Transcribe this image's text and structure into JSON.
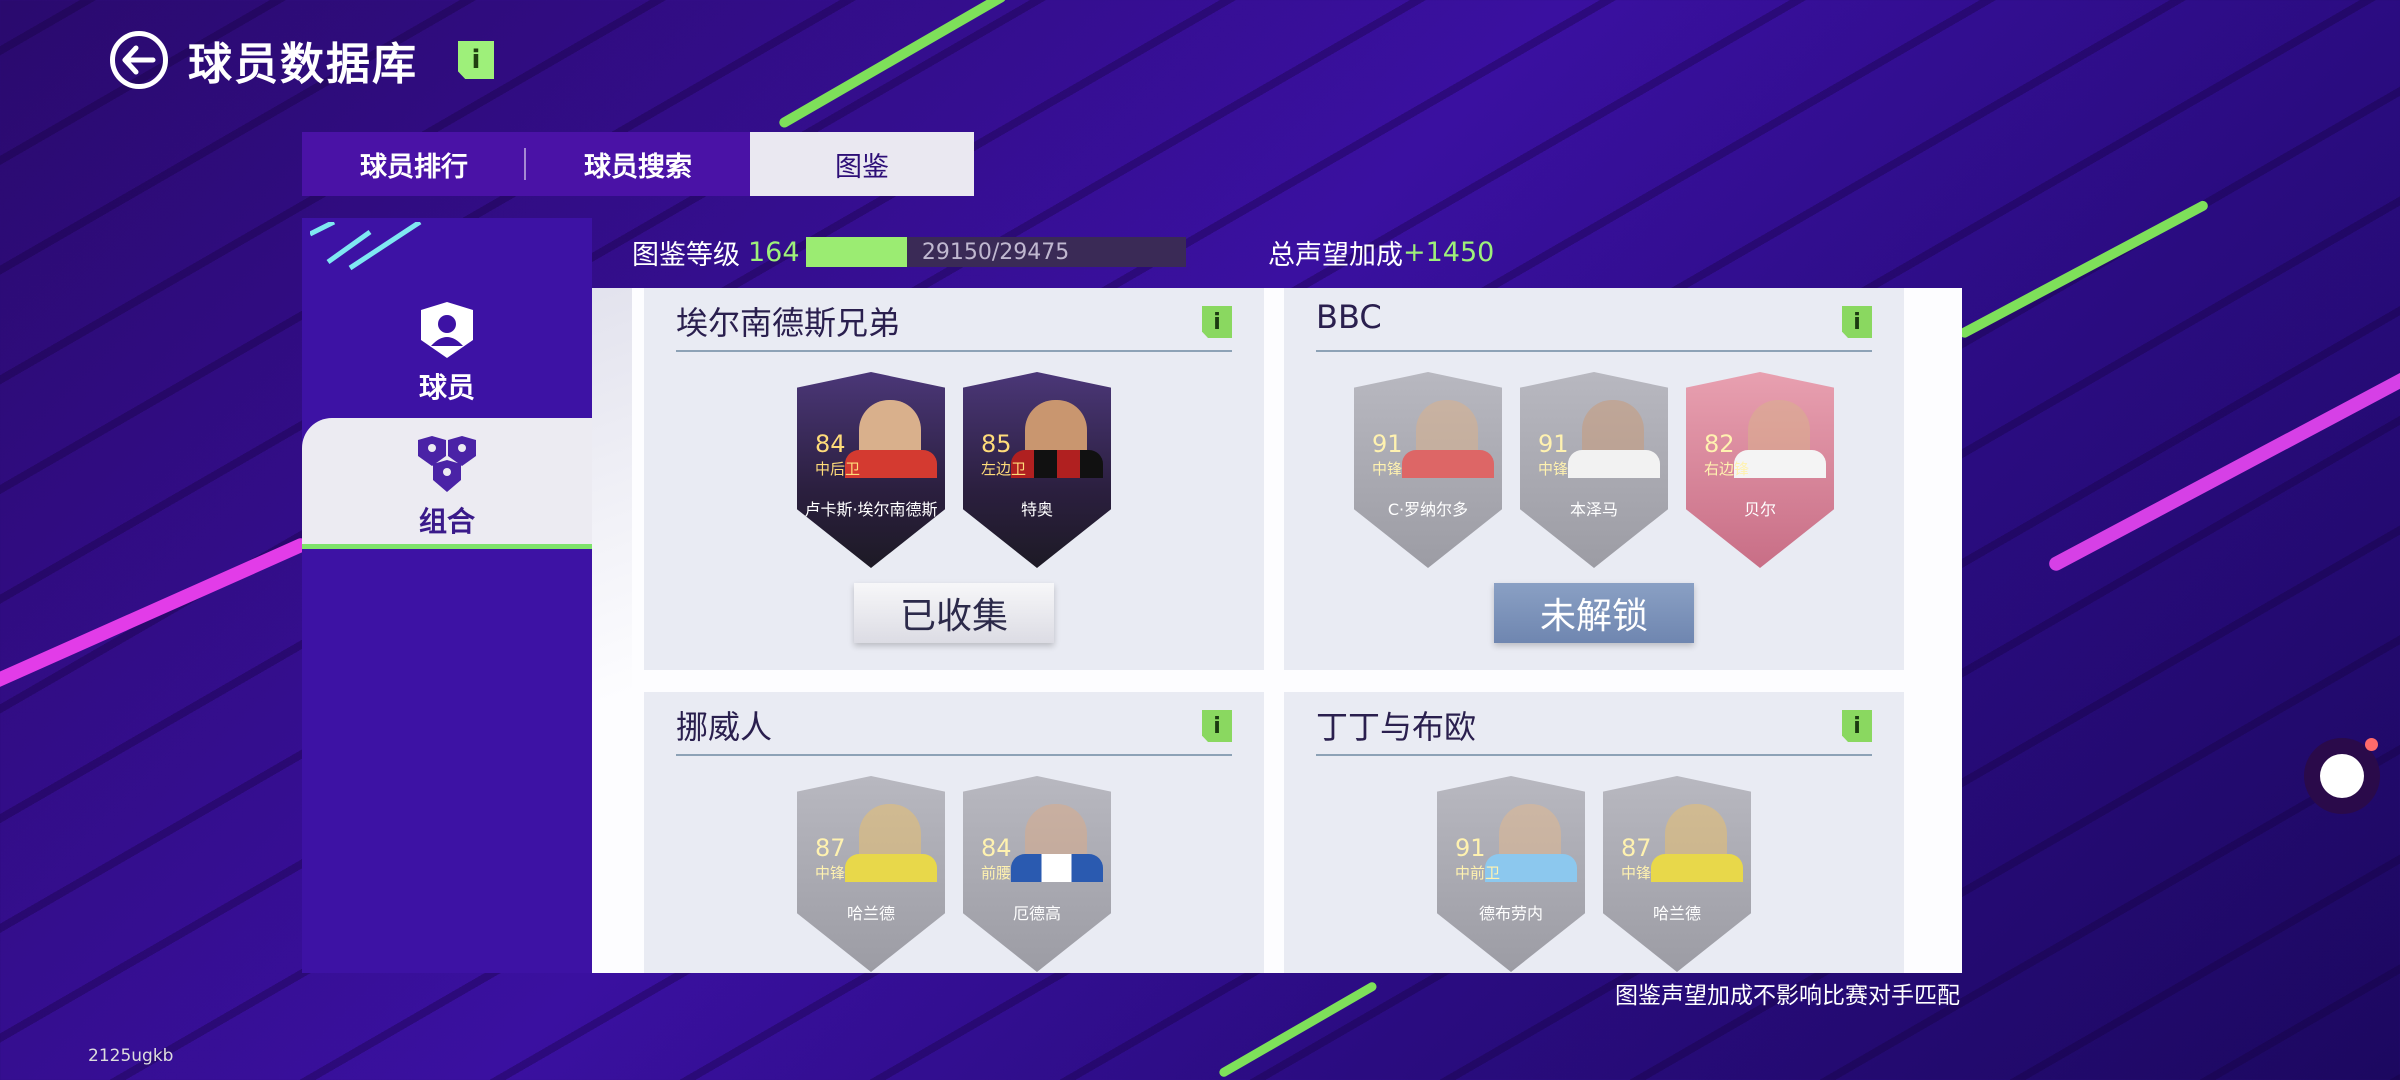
{
  "header": {
    "title": "球员数据库",
    "info_label": "i"
  },
  "tabs": [
    {
      "label": "球员排行"
    },
    {
      "label": "球员搜索"
    },
    {
      "label": "图鉴"
    }
  ],
  "sidebar": {
    "items": [
      {
        "label": "球员"
      },
      {
        "label": "组合"
      }
    ]
  },
  "progress": {
    "level_label": "图鉴等级",
    "level": "164",
    "value_text": "29150/29475",
    "fraction": 0.2668
  },
  "reputation": {
    "label": "总声望加成",
    "value": "+1450"
  },
  "cards": [
    {
      "title": "埃尔南德斯兄弟",
      "status": "已收集",
      "players": [
        {
          "rating": "84",
          "position": "中后卫",
          "name": "卢卡斯·埃尔南德斯"
        },
        {
          "rating": "85",
          "position": "左边卫",
          "name": "特奥"
        }
      ]
    },
    {
      "title": "BBC",
      "status": "未解锁",
      "players": [
        {
          "rating": "91",
          "position": "中锋",
          "name": "C·罗纳尔多"
        },
        {
          "rating": "91",
          "position": "中锋",
          "name": "本泽马"
        },
        {
          "rating": "82",
          "position": "右边锋",
          "name": "贝尔"
        }
      ]
    },
    {
      "title": "挪威人",
      "players": [
        {
          "rating": "87",
          "position": "中锋",
          "name": "哈兰德"
        },
        {
          "rating": "84",
          "position": "前腰",
          "name": "厄德高"
        }
      ]
    },
    {
      "title": "丁丁与布欧",
      "players": [
        {
          "rating": "91",
          "position": "中前卫",
          "name": "德布劳内"
        },
        {
          "rating": "87",
          "position": "中锋",
          "name": "哈兰德"
        }
      ]
    }
  ],
  "footer_note": "图鉴声望加成不影响比赛对手匹配",
  "watermark": "2125ugkb",
  "colors": {
    "accent_green": "#9ef07a",
    "bg_purple": "#3a10a0",
    "streak_pink": "#e040e0"
  }
}
